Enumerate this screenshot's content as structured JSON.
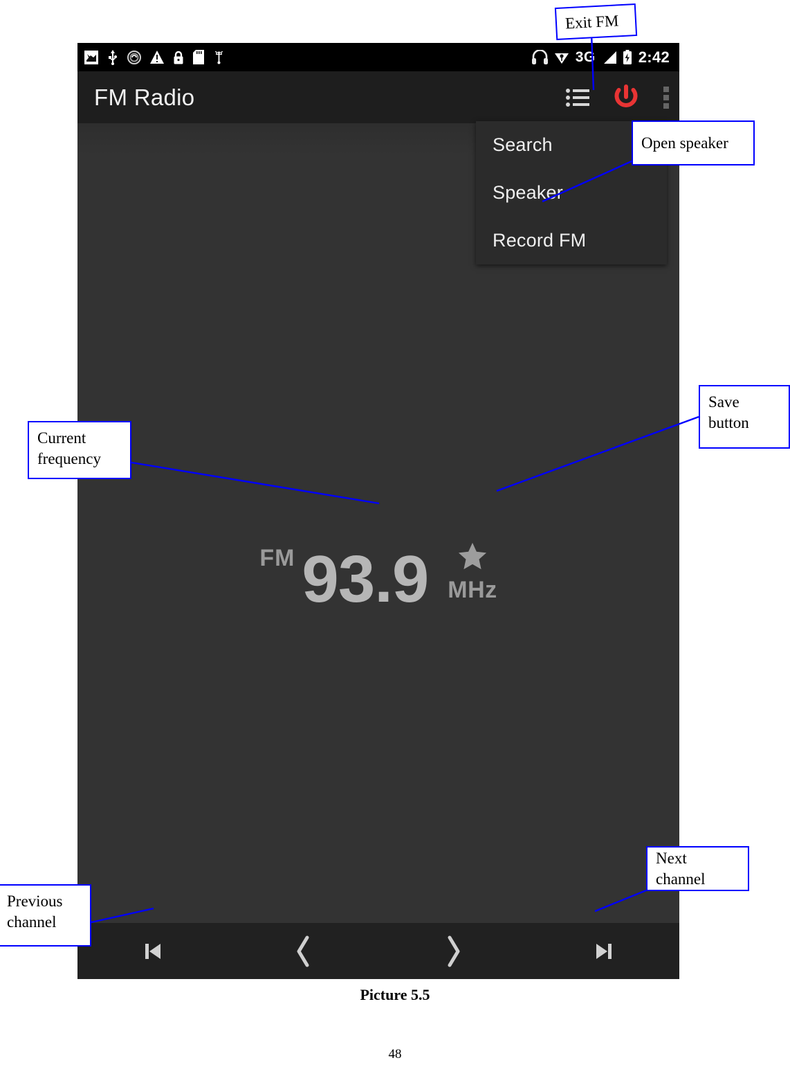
{
  "document": {
    "caption": "Picture 5.5",
    "page_number": "48"
  },
  "phone": {
    "status_bar": {
      "time": "2:42",
      "network_type": "3G",
      "left_icons": [
        "screenshot-icon",
        "usb-icon",
        "sync-circle-icon",
        "warning-triangle-icon",
        "lock-icon",
        "sd-card-icon",
        "android-debug-icon"
      ],
      "right_icons": [
        "headphones-icon",
        "wifi-diamond-icon",
        "signal-bars-icon",
        "battery-charging-icon"
      ]
    },
    "app_bar": {
      "title": "FM Radio",
      "actions": [
        {
          "name": "channel-list",
          "icon": "list-icon"
        },
        {
          "name": "power",
          "icon": "power-icon",
          "color": "#e83434"
        },
        {
          "name": "overflow",
          "icon": "overflow-menu-icon"
        }
      ]
    },
    "menu": {
      "items": [
        {
          "label": "Search"
        },
        {
          "label": "Speaker"
        },
        {
          "label": "Record FM"
        }
      ]
    },
    "player": {
      "band_label": "FM",
      "frequency": "93.9",
      "unit": "MHz",
      "save_icon": "star-icon"
    },
    "controls": [
      {
        "name": "previous-channel",
        "icon": "skip-previous-icon"
      },
      {
        "name": "tune-down",
        "icon": "chevron-left-icon"
      },
      {
        "name": "tune-up",
        "icon": "chevron-right-icon"
      },
      {
        "name": "next-channel",
        "icon": "skip-next-icon"
      }
    ],
    "nav_bar": [
      {
        "name": "back",
        "icon": "back-triangle-icon"
      },
      {
        "name": "home",
        "icon": "home-circle-icon"
      },
      {
        "name": "recents",
        "icon": "recents-square-icon"
      }
    ]
  },
  "annotations": {
    "exit_fm": "Exit FM",
    "open_speaker": "Open speaker",
    "save_button": "Save\nbutton",
    "save_button_line1": "Save",
    "save_button_line2": "button",
    "current_frequency_line1": "Current",
    "current_frequency_line2": "frequency",
    "next_channel": "Next channel",
    "previous_channel_line1": "Previous",
    "previous_channel_line2": "channel"
  },
  "colors": {
    "accent_red": "#e83434",
    "callout_border": "#0000ff",
    "app_bar_bg": "#1e1e1e",
    "content_bg": "#333333"
  }
}
